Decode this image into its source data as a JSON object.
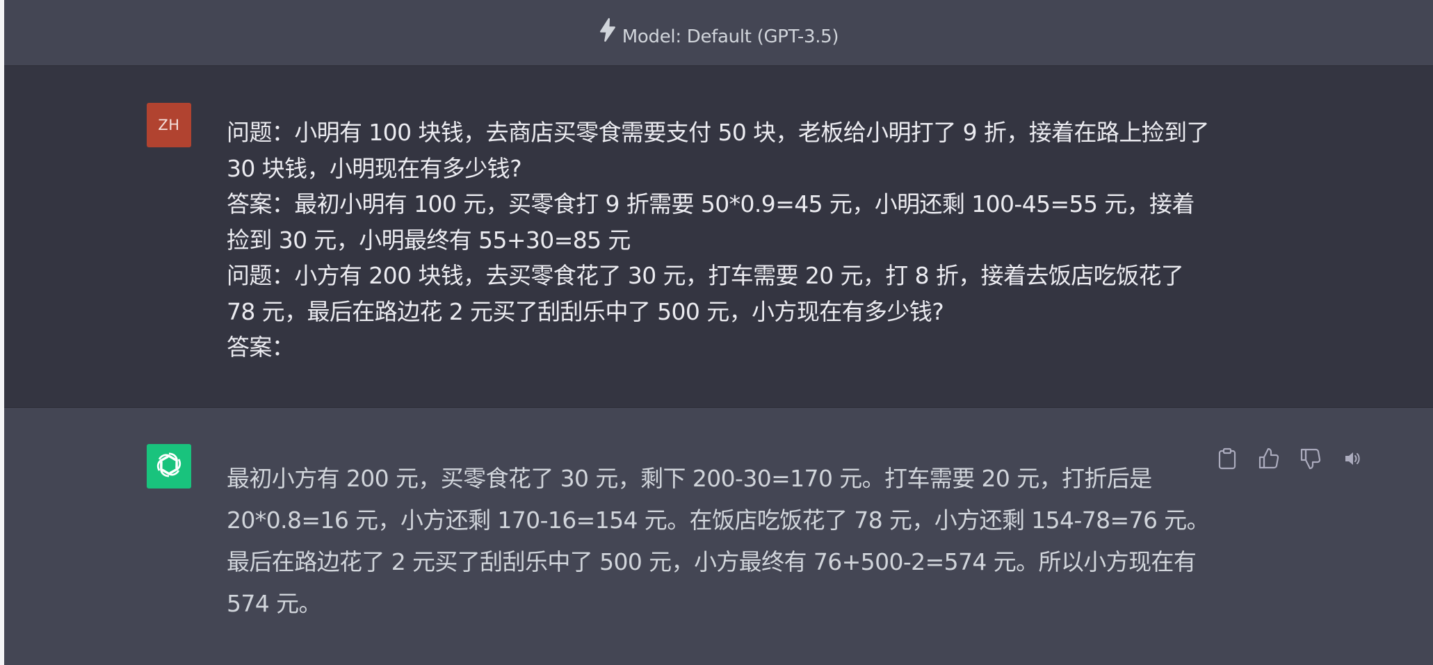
{
  "header": {
    "model_label": "Model: Default (GPT-3.5)",
    "icon": "lightning-bolt-icon"
  },
  "user_message": {
    "avatar_initials": "ZH",
    "avatar_color": "#b14330",
    "paragraphs": [
      "问题：小明有 100 块钱，去商店买零食需要支付 50 块，老板给小明打了 9 折，接着在路上捡到了 30 块钱，小明现在有多少钱?",
      "答案：最初小明有 100 元，买零食打 9 折需要 50*0.9=45 元，小明还剩 100-45=55 元，接着捡到 30 元，小明最终有 55+30=85 元",
      "问题：小方有 200 块钱，去买零食花了 30 元，打车需要 20 元，打 8 折，接着去饭店吃饭花了 78 元，最后在路边花 2 元买了刮刮乐中了 500 元，小方现在有多少钱?",
      "答案："
    ]
  },
  "assistant_message": {
    "avatar_icon": "openai-logo-icon",
    "avatar_color": "#19c37d",
    "text": "最初小方有 200 元，买零食花了 30 元，剩下 200-30=170 元。打车需要 20 元，打折后是 20*0.8=16 元，小方还剩 170-16=154 元。在饭店吃饭花了 78 元，小方还剩 154-78=76 元。最后在路边花了 2 元买了刮刮乐中了 500 元，小方最终有 76+500-2=574 元。所以小方现在有 574 元。",
    "actions": [
      {
        "icon": "clipboard-icon"
      },
      {
        "icon": "thumbs-up-icon"
      },
      {
        "icon": "thumbs-down-icon"
      },
      {
        "icon": "speaker-icon"
      }
    ]
  },
  "colors": {
    "page_background": "#343541",
    "panel_background": "#444654",
    "user_text": "#ececf1",
    "assistant_text": "#d1d5db"
  }
}
